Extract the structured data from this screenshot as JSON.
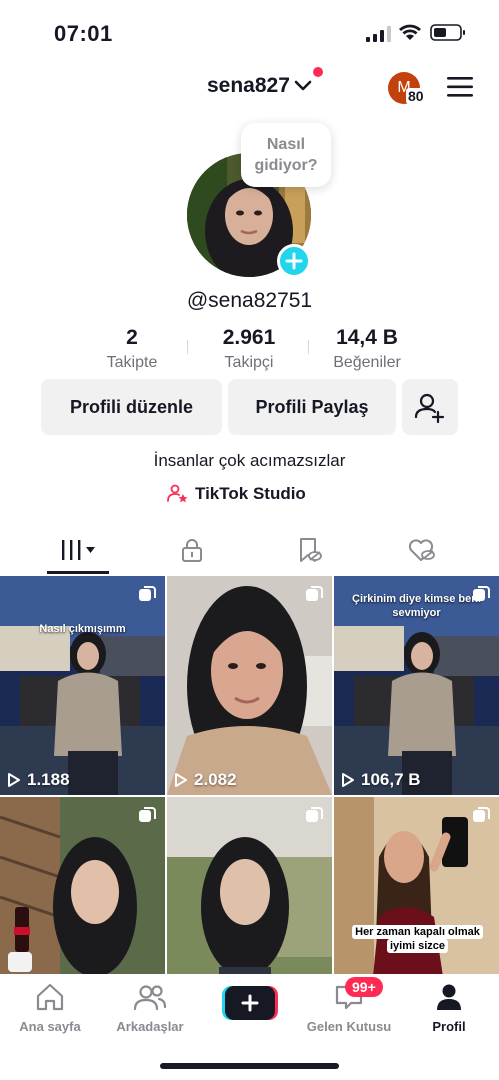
{
  "status_bar": {
    "time": "07:01"
  },
  "header": {
    "username": "sena827",
    "coin_letter": "M",
    "coin_count": "80"
  },
  "profile": {
    "greeting_bubble_line1": "Nasıl",
    "greeting_bubble_line2": "gidiyor?",
    "handle": "@sena82751",
    "stats": [
      {
        "value": "2",
        "label": "Takipte"
      },
      {
        "value": "2.961",
        "label": "Takipçi"
      },
      {
        "value": "14,4 B",
        "label": "Beğeniler"
      }
    ],
    "edit_button": "Profili düzenle",
    "share_button": "Profili Paylaş",
    "bio": "İnsanlar çok acımazsızlar",
    "studio_link": "TikTok Studio"
  },
  "videos": [
    {
      "views": "1.188",
      "caption": "Nasıl çıkmışımm"
    },
    {
      "views": "2.082",
      "caption": ""
    },
    {
      "views": "106,7 B",
      "caption_line1": "Çirkinim diye kimse beni",
      "caption_line2": "sevmiyor"
    },
    {
      "views": "",
      "caption": ""
    },
    {
      "views": "",
      "caption": ""
    },
    {
      "views": "",
      "caption_line1": "Her zaman kapalı olmak",
      "caption_line2": "iyimi sizce"
    }
  ],
  "nav": {
    "home": "Ana sayfa",
    "friends": "Arkadaşlar",
    "inbox": "Gelen Kutusu",
    "inbox_badge": "99+",
    "profile": "Profil"
  },
  "colors": {
    "accent": "#fe2c55",
    "cyan": "#20d5ec",
    "text": "#161823",
    "muted": "#8a8b91"
  }
}
